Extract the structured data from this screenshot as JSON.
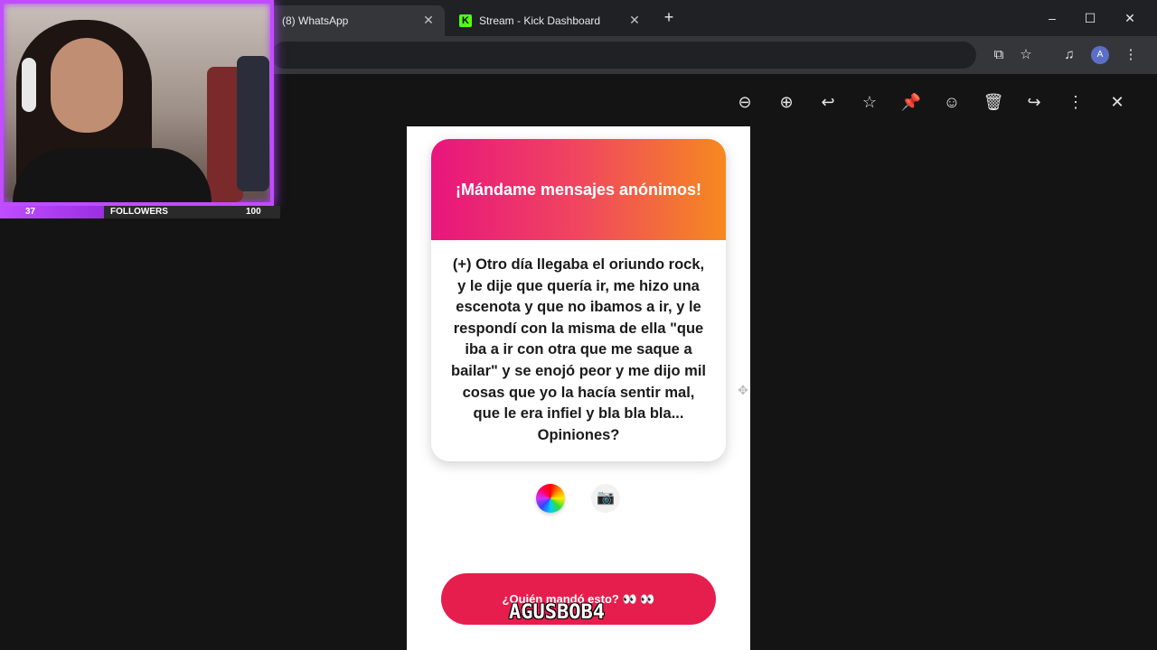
{
  "browser": {
    "tabs": [
      {
        "title": "(8) WhatsApp",
        "active": true
      },
      {
        "title": "Stream - Kick Dashboard",
        "active": false
      }
    ],
    "new_tab_icon": "plus-icon",
    "window_controls": [
      "minimize-icon",
      "maximize-icon",
      "close-icon"
    ],
    "profile_initial": "A"
  },
  "viewer_toolbar": {
    "icons": [
      "zoom-out-icon",
      "zoom-in-icon",
      "reply-icon",
      "star-icon",
      "pin-icon",
      "emoji-icon",
      "delete-icon",
      "forward-icon",
      "more-icon",
      "close-icon"
    ]
  },
  "card": {
    "header": "¡Mándame mensajes anónimos!",
    "lines": [
      "(+) Otro día llegaba el oriundo rock,",
      "y le dije que quería ir, me hizo una",
      "escenota y que no ibamos a ir, y le",
      "respondí con la misma de ella \"que",
      "iba a ir con otra que me saque a",
      "bailar\" y se enojó peor y me dijo mil",
      "cosas que yo la hacía sentir mal,",
      "que le era infiel y bla bla bla...",
      "Opiniones?"
    ],
    "gradient_colors": [
      "#e8157e",
      "#f58a1f"
    ]
  },
  "actions": {
    "who_button": "¿Quién mandó esto? 👀 👀",
    "watermark": "AGUSBOB4",
    "button_color": "#e61e4d"
  },
  "stream_overlay": {
    "followers_label": "FOLLOWERS",
    "current": "37",
    "goal": "100",
    "progress": 0.37,
    "accent": "#c04dff"
  }
}
